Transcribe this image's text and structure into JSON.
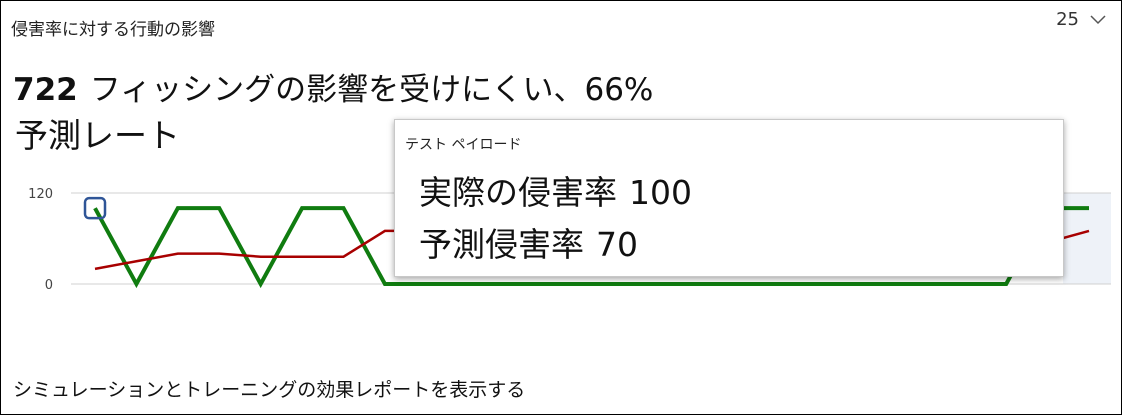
{
  "card": {
    "title": "侵害率に対する行動の影響",
    "range_value": "25",
    "headline_number": "722",
    "headline_text": "フィッシングの影響を受けにくい、66%",
    "subline": "予測レート",
    "footer_link": "シミュレーションとトレーニングの効果レポートを表示する"
  },
  "tooltip": {
    "title": "テスト ペイロード",
    "actual_label": "実際の侵害率",
    "actual_value": "100",
    "predicted_label": "予測侵害率",
    "predicted_value": "70"
  },
  "colors": {
    "actual_series": "#107c10",
    "predicted_series": "#a80000",
    "gridline": "#d0d0d0",
    "highlight_marker": "#2f5597",
    "band": "#eef2f8"
  },
  "chart_data": {
    "type": "line",
    "ylim": [
      0,
      120
    ],
    "yticks": [
      "120",
      "0"
    ],
    "x": [
      1,
      2,
      3,
      4,
      5,
      6,
      7,
      8,
      9,
      10,
      11,
      12,
      13,
      14,
      15,
      16,
      17,
      18,
      19,
      20,
      21,
      22,
      23,
      24,
      25
    ],
    "series": [
      {
        "key": "actual",
        "values": [
          100,
          0,
          100,
          100,
          0,
          100,
          100,
          0,
          0,
          0,
          0,
          0,
          0,
          0,
          0,
          0,
          0,
          0,
          0,
          0,
          0,
          0,
          0,
          100,
          100
        ],
        "color": "#107c10"
      },
      {
        "key": "predicted",
        "values": [
          20,
          30,
          40,
          40,
          36,
          36,
          36,
          70,
          70,
          70,
          70,
          70,
          70,
          70,
          70,
          70,
          70,
          70,
          70,
          70,
          70,
          70,
          70,
          55,
          70
        ],
        "color": "#a80000"
      }
    ],
    "highlight_index": 0
  }
}
